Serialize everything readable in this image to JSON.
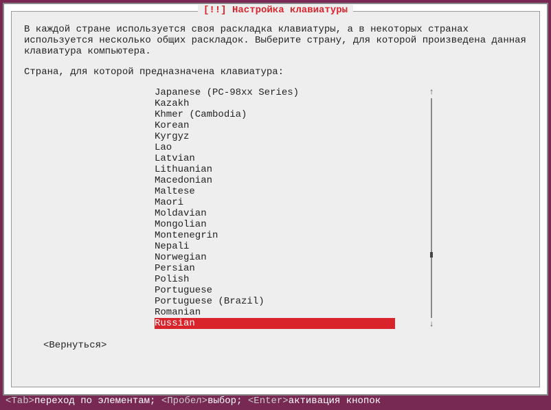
{
  "title": "[!!] Настройка клавиатуры",
  "description": "В каждой стране используется своя раскладка клавиатуры, а в некоторых странах\nиспользуется несколько общих раскладок. Выберите страну, для которой произведена данная\nклавиатура компьютера.",
  "prompt": "Страна, для которой предназначена клавиатура:",
  "list": {
    "items": [
      {
        "label": "Japanese (PC-98xx Series)",
        "selected": false
      },
      {
        "label": "Kazakh",
        "selected": false
      },
      {
        "label": "Khmer (Cambodia)",
        "selected": false
      },
      {
        "label": "Korean",
        "selected": false
      },
      {
        "label": "Kyrgyz",
        "selected": false
      },
      {
        "label": "Lao",
        "selected": false
      },
      {
        "label": "Latvian",
        "selected": false
      },
      {
        "label": "Lithuanian",
        "selected": false
      },
      {
        "label": "Macedonian",
        "selected": false
      },
      {
        "label": "Maltese",
        "selected": false
      },
      {
        "label": "Maori",
        "selected": false
      },
      {
        "label": "Moldavian",
        "selected": false
      },
      {
        "label": "Mongolian",
        "selected": false
      },
      {
        "label": "Montenegrin",
        "selected": false
      },
      {
        "label": "Nepali",
        "selected": false
      },
      {
        "label": "Norwegian",
        "selected": false
      },
      {
        "label": "Persian",
        "selected": false
      },
      {
        "label": "Polish",
        "selected": false
      },
      {
        "label": "Portuguese",
        "selected": false
      },
      {
        "label": "Portuguese (Brazil)",
        "selected": false
      },
      {
        "label": "Romanian",
        "selected": false
      },
      {
        "label": "Russian",
        "selected": true
      }
    ],
    "scroll_up": "↑",
    "scroll_down": "↓"
  },
  "back_label": "<Вернуться>",
  "footer": {
    "tab": "<Tab>",
    "tab_text": "переход по элементам; ",
    "space": "<Пробел>",
    "space_text": "выбор; ",
    "enter": "<Enter>",
    "enter_text": "активация кнопок"
  }
}
